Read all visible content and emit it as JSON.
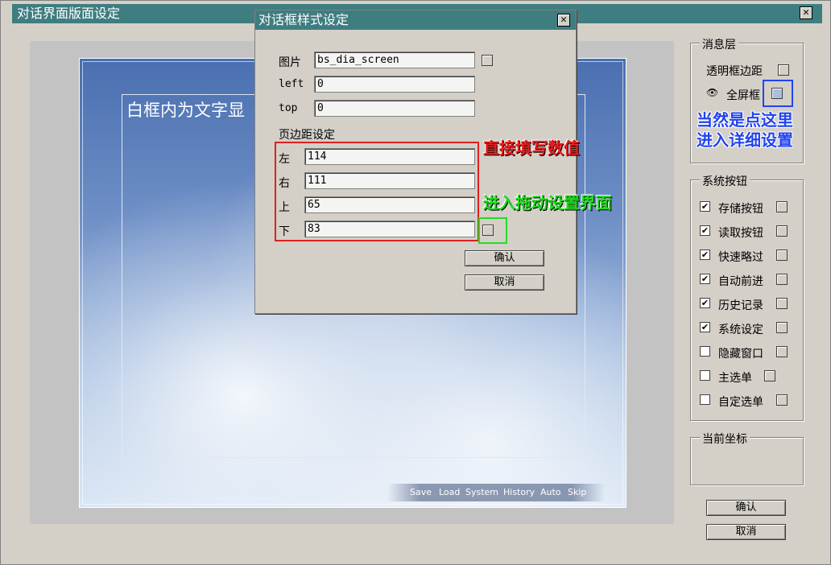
{
  "window": {
    "title": "对话界面版面设定",
    "close_glyph": "✕"
  },
  "preview": {
    "textbox_label": "白框内为文字显",
    "sysbar": [
      "Save",
      "Load",
      "System",
      "History",
      "Auto",
      "Skip"
    ]
  },
  "message_layer": {
    "title": "消息层",
    "transparent_margin_label": "透明框边距",
    "fullscreen_label": "全屏框",
    "fullscreen_icon": "eye-icon"
  },
  "system_buttons": {
    "title": "系统按钮",
    "items": [
      {
        "label": "存储按钮",
        "checked": true
      },
      {
        "label": "读取按钮",
        "checked": true
      },
      {
        "label": "快速略过",
        "checked": true
      },
      {
        "label": "自动前进",
        "checked": true
      },
      {
        "label": "历史记录",
        "checked": true
      },
      {
        "label": "系统设定",
        "checked": true
      },
      {
        "label": "隐藏窗口",
        "checked": false
      },
      {
        "label": "主选单",
        "checked": false
      },
      {
        "label": "自定选单",
        "checked": false
      }
    ]
  },
  "coords": {
    "title": "当前坐标"
  },
  "main_buttons": {
    "ok": "确认",
    "cancel": "取消"
  },
  "dialog": {
    "title": "对话框样式设定",
    "image_label": "图片",
    "image_value": "bs_dia_screen",
    "left_label": "left",
    "left_value": "0",
    "top_label": "top",
    "top_value": "0",
    "margin_title": "页边距设定",
    "margins": [
      {
        "label": "左",
        "value": "114"
      },
      {
        "label": "右",
        "value": "111"
      },
      {
        "label": "上",
        "value": "65"
      },
      {
        "label": "下",
        "value": "83"
      }
    ],
    "ok": "确认",
    "cancel": "取消"
  },
  "annotations": {
    "direct_input": "直接填写数值",
    "drag_setup": "进入拖动设置界面",
    "click_here_line1": "当然是点这里",
    "click_here_line2": "进入详细设置"
  },
  "colors": {
    "titlebar": "#3e7d80",
    "annot_red": "#e82020",
    "annot_green": "#22dd22",
    "annot_blue": "#2244ee"
  }
}
